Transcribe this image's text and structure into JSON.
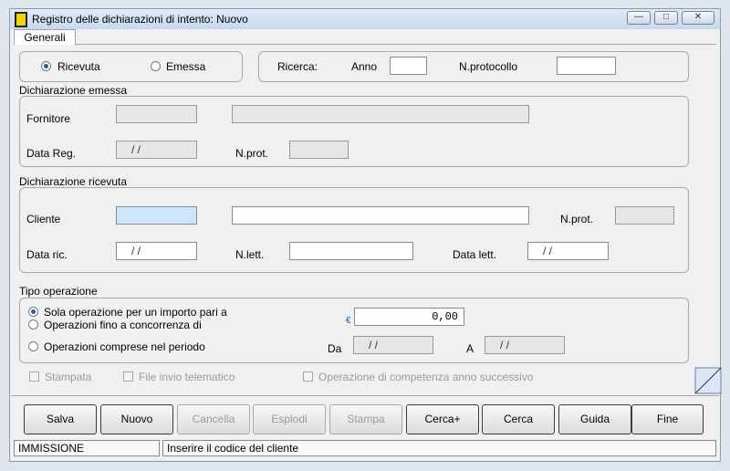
{
  "window": {
    "title": "Registro delle dichiarazioni di intento: Nuovo"
  },
  "tabs": [
    {
      "label": "Generali"
    }
  ],
  "radio_type": {
    "received_label": "Ricevuta",
    "issued_label": "Emessa",
    "selected": "Ricevuta"
  },
  "search": {
    "label": "Ricerca:",
    "year_label": "Anno",
    "year_value": "",
    "protocol_label": "N.protocollo",
    "protocol_value": ""
  },
  "issued_section": {
    "title": "Dichiarazione emessa",
    "supplier_label": "Fornitore",
    "supplier_code": "",
    "supplier_name": "",
    "reg_date_label": "Data Reg.",
    "reg_date_value": "/   /",
    "prot_label": "N.prot.",
    "prot_value": ""
  },
  "received_section": {
    "title": "Dichiarazione ricevuta",
    "customer_label": "Cliente",
    "customer_code": "",
    "customer_name": "",
    "prot_label": "N.prot.",
    "prot_value": "",
    "recv_date_label": "Data ric.",
    "recv_date_value": "/   /",
    "letter_no_label": "N.lett.",
    "letter_no_value": "",
    "letter_date_label": "Data lett.",
    "letter_date_value": "/   /"
  },
  "operation": {
    "title": "Tipo operazione",
    "option_single": "Sola operazione per un importo pari a",
    "option_up_to": "Operazioni fino a concorrenza di",
    "option_period": "Operazioni comprese nel periodo",
    "selected": "Sola operazione per un importo pari a",
    "currency_symbol": "€",
    "amount": "0,00",
    "from_label": "Da",
    "from_value": "/   /",
    "to_label": "A",
    "to_value": "/   /"
  },
  "flags": {
    "printed_label": "Stampata",
    "telematic_label": "File invio telematico",
    "next_year_label": "Operazione di competenza anno successivo"
  },
  "buttons": [
    {
      "label": "Salva",
      "enabled": true
    },
    {
      "label": "Nuovo",
      "enabled": true
    },
    {
      "label": "Cancella",
      "enabled": false
    },
    {
      "label": "Esplodi",
      "enabled": false
    },
    {
      "label": "Stampa",
      "enabled": false
    },
    {
      "label": "Cerca+",
      "enabled": true
    },
    {
      "label": "Cerca",
      "enabled": true
    },
    {
      "label": "Guida",
      "enabled": true
    },
    {
      "label": "Fine",
      "enabled": true
    }
  ],
  "status": {
    "mode": "IMMISSIONE",
    "message": "Inserire il codice del cliente"
  },
  "window_controls": {
    "minimize": "—",
    "maximize": "□",
    "close": "✕"
  },
  "colors": {
    "required_field": "#cce6fb",
    "selected_radio": "#2a5ea8"
  },
  "icons": {
    "app": "app-icon",
    "corner": "resize-corner-icon"
  }
}
